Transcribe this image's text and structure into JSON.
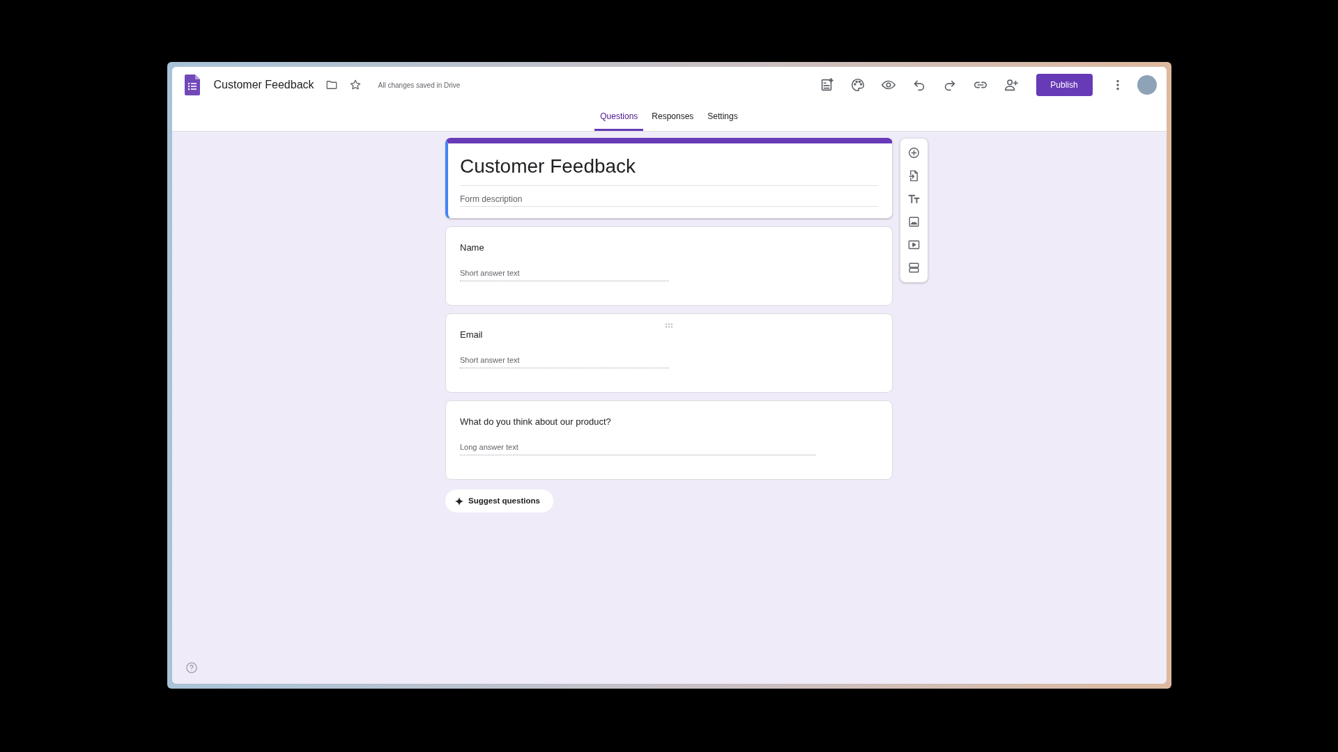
{
  "header": {
    "doc_title": "Customer Feedback",
    "save_status": "All changes saved in Drive",
    "publish_label": "Publish"
  },
  "tabs": [
    {
      "label": "Questions",
      "selected": true
    },
    {
      "label": "Responses",
      "selected": false
    },
    {
      "label": "Settings",
      "selected": false
    }
  ],
  "form": {
    "title": "Customer Feedback",
    "description_placeholder": "Form description"
  },
  "questions": [
    {
      "title": "Name",
      "kind": "short",
      "placeholder": "Short answer text",
      "hovered": false
    },
    {
      "title": "Email",
      "kind": "short",
      "placeholder": "Short answer text",
      "hovered": true
    },
    {
      "title": "What do you think about our product?",
      "kind": "long",
      "placeholder": "Long answer text",
      "hovered": false
    }
  ],
  "suggest_button": {
    "label": "Suggest questions"
  }
}
